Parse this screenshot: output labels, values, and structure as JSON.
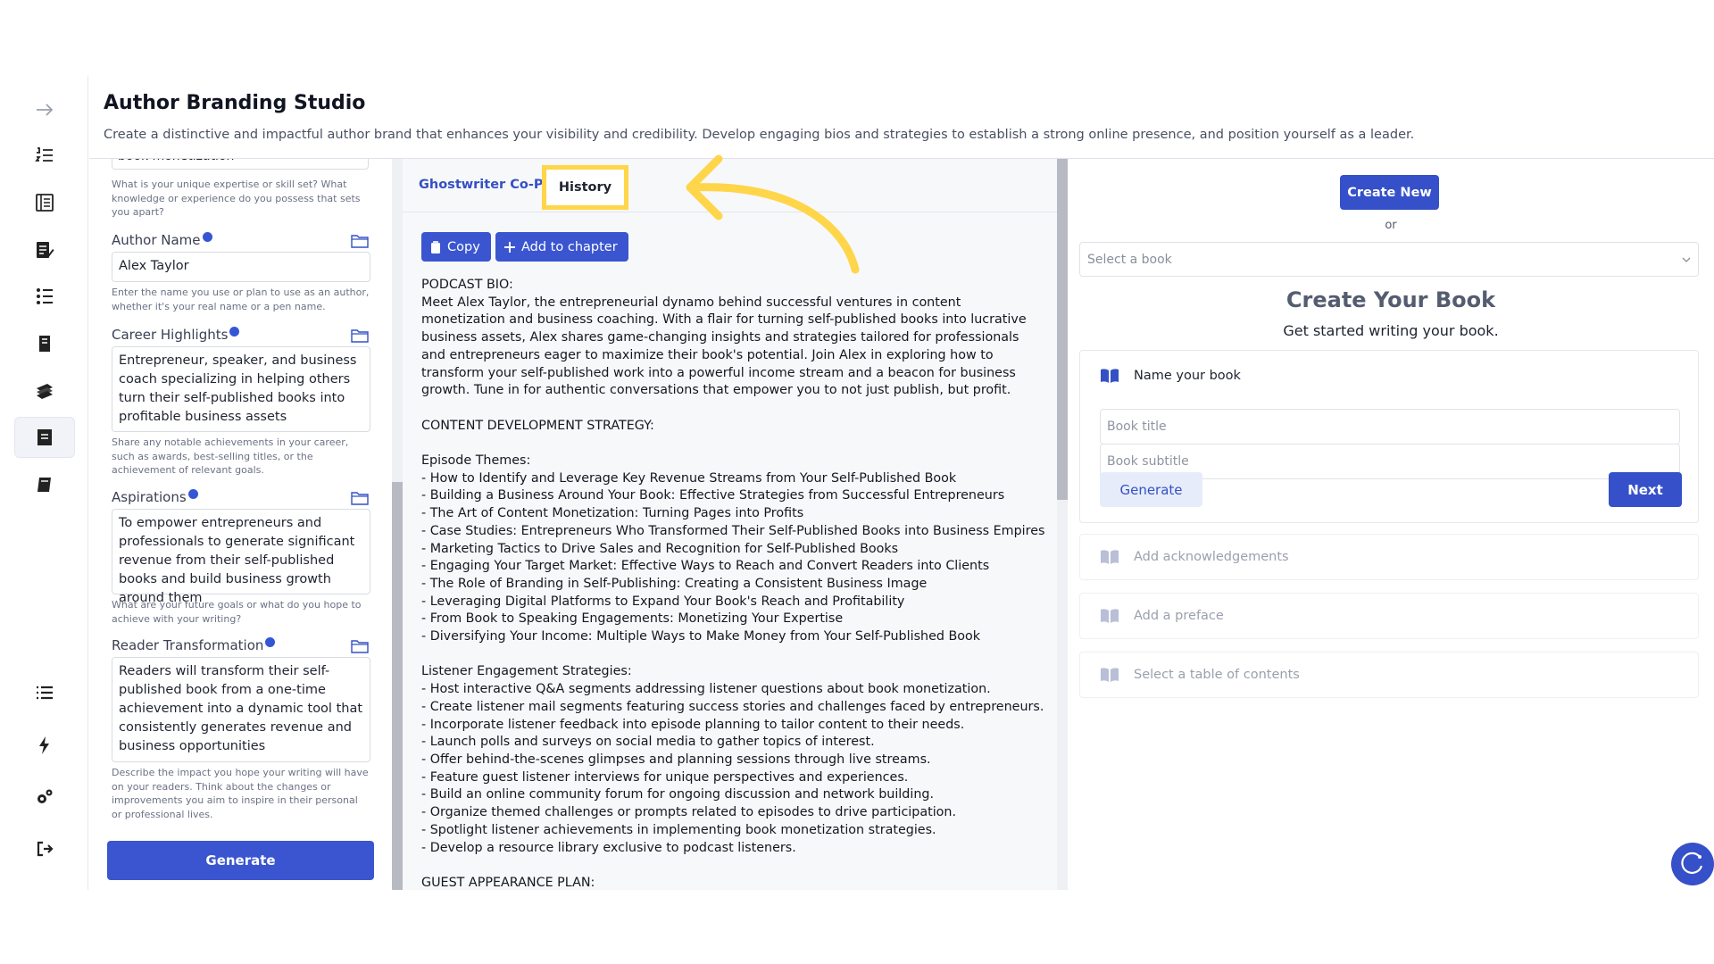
{
  "header": {
    "title": "Author Branding Studio",
    "subtitle": "Create a distinctive and impactful author brand that enhances your visibility and credibility. Develop engaging bios and strategies to establish a strong online presence, and position yourself as a leader."
  },
  "rail": {
    "icons": [
      "arrow-right-icon",
      "numbered-list-icon",
      "book-layout-icon",
      "edit-document-icon",
      "checklist-icon",
      "book-pages-icon",
      "books-stack-icon",
      "archive-box-icon",
      "book-icon",
      "list-icon",
      "lightning-icon",
      "gears-icon",
      "logout-icon"
    ]
  },
  "form": {
    "top_field_value": "book monetization",
    "top_help": "What is your unique expertise or skill set? What knowledge or experience do you possess that sets you apart?",
    "author_name": {
      "label": "Author Name",
      "value": "Alex Taylor",
      "help": "Enter the name you use or plan to use as an author, whether it's your real name or a pen name."
    },
    "career": {
      "label": "Career Highlights",
      "value": "Entrepreneur, speaker, and business coach specializing in helping others turn their self-published books into profitable business assets",
      "help": "Share any notable achievements in your career, such as awards, best-selling titles, or the achievement of relevant goals."
    },
    "aspirations": {
      "label": "Aspirations",
      "value": "To empower entrepreneurs and professionals to generate significant revenue from their self-published books and build business growth around them",
      "help": "What are your future goals or what do you hope to achieve with your writing?"
    },
    "reader": {
      "label": "Reader Transformation",
      "value": "Readers will transform their self-published book from a one-time achievement into a dynamic tool that consistently generates revenue and business opportunities",
      "help": "Describe the impact you hope your writing will have on your readers. Think about the changes or improvements you aim to inspire in their personal or professional lives."
    },
    "generate_label": "Generate"
  },
  "middle": {
    "tab_copilot": "Ghostwriter Co-Pilot",
    "tab_history": "History",
    "copy_label": "Copy",
    "add_chapter_label": "Add to chapter",
    "document": "PODCAST BIO:\nMeet Alex Taylor, the entrepreneurial dynamo behind successful ventures in content monetization and business coaching. With a flair for turning self-published books into lucrative business assets, Alex shares game-changing insights and strategies tailored for professionals and entrepreneurs eager to maximize their book's potential. Join Alex in exploring how to transform your self-published work into a powerful income stream and a beacon for business growth. Tune in for authentic conversations that empower you to not just publish, but profit.\n\nCONTENT DEVELOPMENT STRATEGY:\n\nEpisode Themes:\n- How to Identify and Leverage Key Revenue Streams from Your Self-Published Book\n- Building a Business Around Your Book: Effective Strategies from Successful Entrepreneurs\n- The Art of Content Monetization: Turning Pages into Profits\n- Case Studies: Entrepreneurs Who Transformed Their Self-Published Books into Business Empires\n- Marketing Tactics to Drive Sales and Recognition for Self-Published Books\n- Engaging Your Target Market: Effective Ways to Reach and Convert Readers into Clients\n- The Role of Branding in Self-Publishing: Creating a Consistent Business Image\n- Leveraging Digital Platforms to Expand Your Book's Reach and Profitability\n- From Book to Speaking Engagements: Monetizing Your Expertise\n- Diversifying Your Income: Multiple Ways to Make Money from Your Self-Published Book\n\nListener Engagement Strategies:\n- Host interactive Q&A segments addressing listener questions about book monetization.\n- Create listener mail segments featuring success stories and challenges faced by entrepreneurs.\n- Incorporate listener feedback into episode planning to tailor content to their needs.\n- Launch polls and surveys on social media to gather topics of interest.\n- Offer behind-the-scenes glimpses and planning sessions through live streams.\n- Feature guest listener interviews for unique perspectives and experiences.\n- Build an online community forum for ongoing discussion and network building.\n- Organize themed challenges or prompts related to episodes to drive participation.\n- Spotlight listener achievements in implementing book monetization strategies.\n- Develop a resource library exclusive to podcast listeners.\n\nGUEST APPEARANCE PLAN:"
  },
  "right": {
    "create_new": "Create New",
    "or": "or",
    "select_placeholder": "Select a book",
    "heading": "Create Your Book",
    "subheading": "Get started writing your book.",
    "name_step": "Name your book",
    "title_placeholder": "Book title",
    "subtitle_placeholder": "Book subtitle",
    "generate_label": "Generate",
    "next_label": "Next",
    "steps": [
      "Add acknowledgements",
      "Add a preface",
      "Select a table of contents"
    ]
  },
  "colors": {
    "primary": "#3a55cf",
    "highlight": "#ffd54a"
  }
}
